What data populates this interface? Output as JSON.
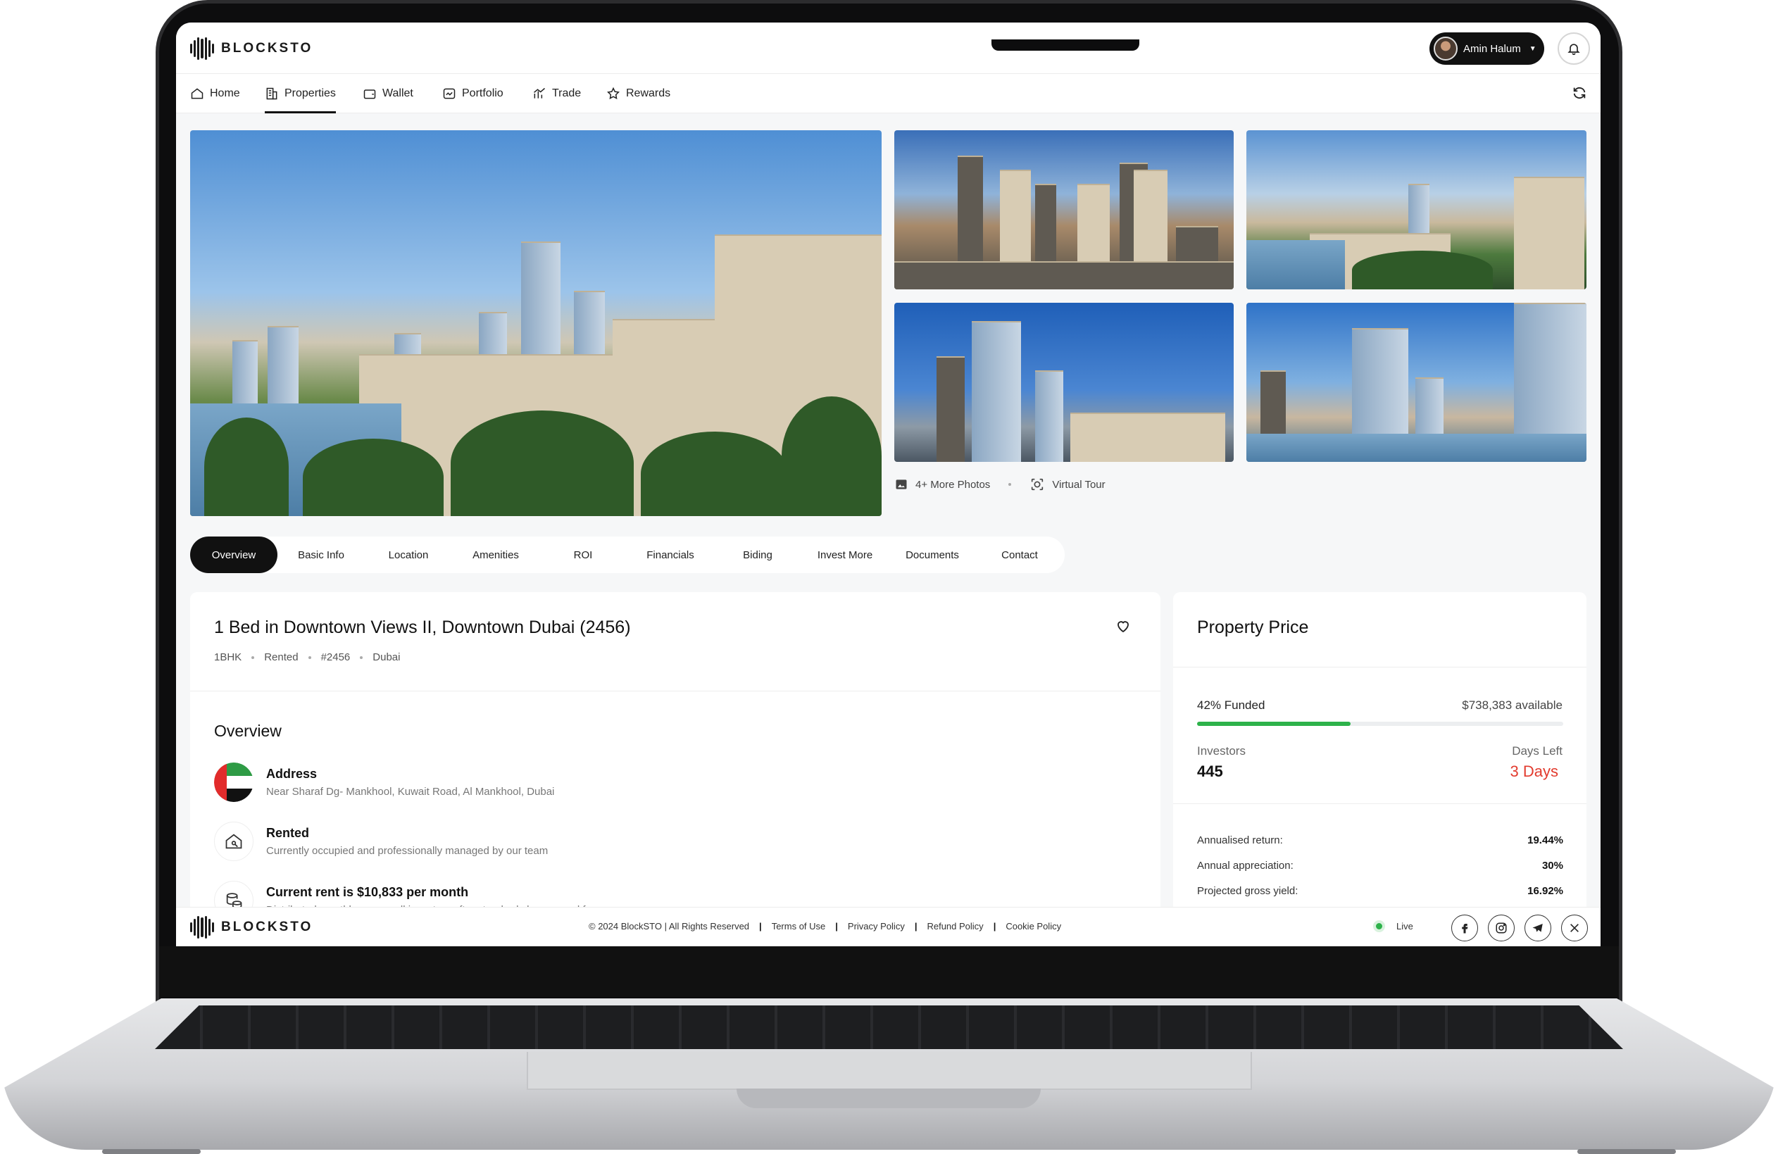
{
  "brand": {
    "name": "BLOCKSTO"
  },
  "user": {
    "name": "Amin Halum"
  },
  "nav": {
    "items": [
      {
        "label": "Home",
        "icon": "home-icon"
      },
      {
        "label": "Properties",
        "icon": "building-icon",
        "active": true
      },
      {
        "label": "Wallet",
        "icon": "wallet-icon"
      },
      {
        "label": "Portfolio",
        "icon": "portfolio-icon"
      },
      {
        "label": "Trade",
        "icon": "chart-icon"
      },
      {
        "label": "Rewards",
        "icon": "star-icon"
      }
    ]
  },
  "gallery": {
    "more_photos": "4+ More Photos",
    "virtual_tour": "Virtual Tour"
  },
  "tabs": {
    "items": [
      "Overview",
      "Basic Info",
      "Location",
      "Amenities",
      "ROI",
      "Financials",
      "Biding",
      "Invest More",
      "Documents",
      "Contact"
    ],
    "active": "Overview"
  },
  "property": {
    "title": "1 Bed in Downtown Views II, Downtown Dubai (2456)",
    "meta": [
      "1BHK",
      "Rented",
      "#2456",
      "Dubai"
    ]
  },
  "overview": {
    "title": "Overview",
    "rows": [
      {
        "head": "Address",
        "sub": "Near Sharaf Dg- Mankhool, Kuwait Road, Al Mankhool, Dubai",
        "icon": "uae-flag-icon"
      },
      {
        "head": "Rented",
        "sub": "Currently occupied and professionally managed by our team",
        "icon": "house-key-icon"
      },
      {
        "head": "Current rent is $10,833 per month",
        "sub": "Distributed monthly among all investors after standard charges and fees",
        "icon": "coins-icon"
      }
    ]
  },
  "price": {
    "title": "Property Price",
    "funded_label": "42% Funded",
    "funded_fraction": 0.42,
    "available": "$738,383 available",
    "investors_label": "Investors",
    "investors": "445",
    "days_label": "Days Left",
    "days": "3 Days",
    "stats": [
      {
        "label": "Annualised return:",
        "value": "19.44%"
      },
      {
        "label": "Annual appreciation:",
        "value": "30%"
      },
      {
        "label": "Projected gross yield:",
        "value": "16.92%"
      }
    ]
  },
  "footer": {
    "copyright": "© 2024 BlockSTO | All Rights Reserved",
    "links": [
      "Terms of Use",
      "Privacy Policy",
      "Refund Policy",
      "Cookie Policy"
    ],
    "status": "Live",
    "social": [
      "facebook-icon",
      "instagram-icon",
      "telegram-icon",
      "x-icon"
    ]
  },
  "colors": {
    "accent_green": "#2db24a",
    "days_red": "#e23b2e",
    "dark": "#111111"
  }
}
